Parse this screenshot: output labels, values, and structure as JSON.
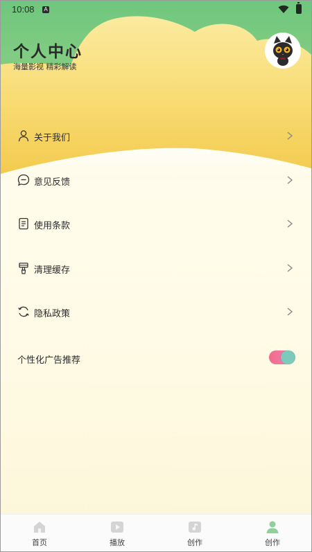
{
  "status_bar": {
    "time": "10:08",
    "app_indicator": "A"
  },
  "header": {
    "title": "个人中心",
    "subtitle": "海量影视 精彩解读",
    "avatar_icon": "black-cat-avatar"
  },
  "menu": {
    "items": [
      {
        "label": "关于我们",
        "icon": "person-icon"
      },
      {
        "label": "意见反馈",
        "icon": "chat-bubble-icon"
      },
      {
        "label": "使用条款",
        "icon": "document-icon"
      },
      {
        "label": "清理缓存",
        "icon": "brush-icon"
      },
      {
        "label": "隐私政策",
        "icon": "refresh-icon"
      }
    ]
  },
  "ad_setting": {
    "label": "个性化广告推荐",
    "enabled": true
  },
  "bottom_nav": {
    "tabs": [
      {
        "label": "首页",
        "icon": "home-icon"
      },
      {
        "label": "播放",
        "icon": "play-icon"
      },
      {
        "label": "创作",
        "icon": "music-note-icon"
      },
      {
        "label": "创作",
        "icon": "profile-icon",
        "active": true
      }
    ]
  },
  "colors": {
    "header_green": "#7cc98a",
    "cloud_yellow": "#f7d86a",
    "toggle_pink": "#f26a8c",
    "toggle_teal": "#7dc9bb"
  }
}
